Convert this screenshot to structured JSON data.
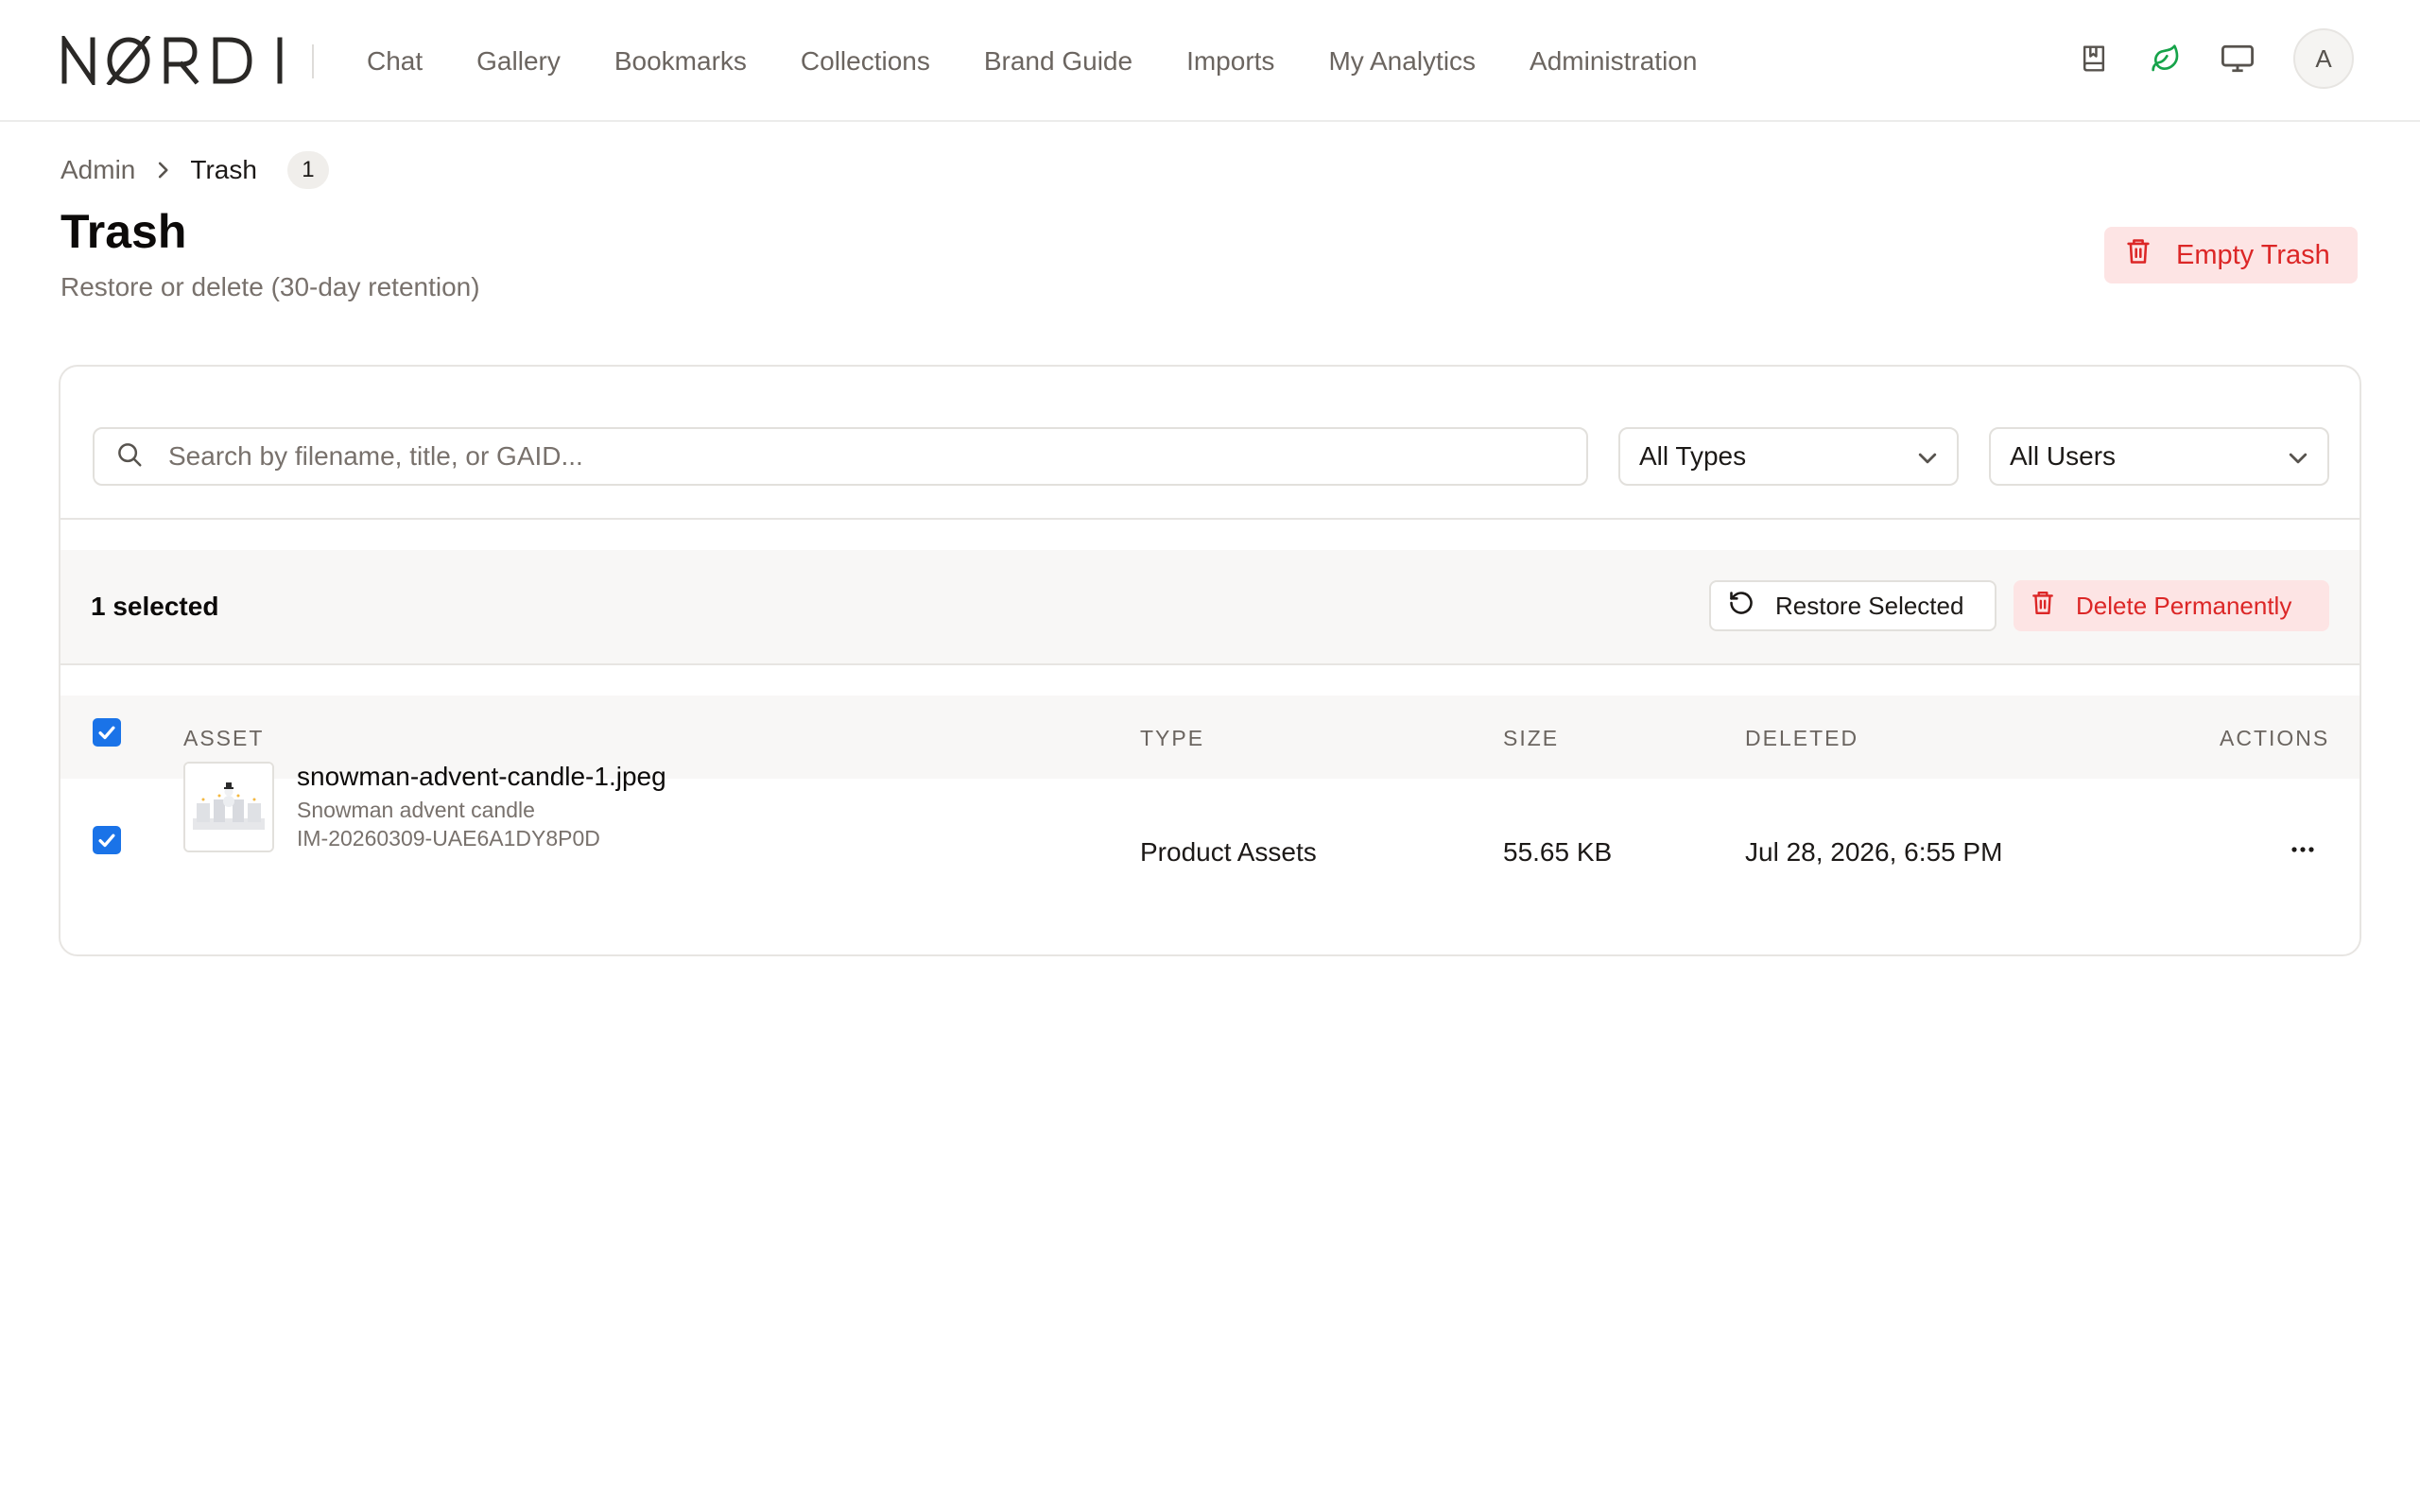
{
  "brand": {
    "logo_text": "NØRDI"
  },
  "nav": {
    "items": [
      "Chat",
      "Gallery",
      "Bookmarks",
      "Collections",
      "Brand Guide",
      "Imports",
      "My Analytics",
      "Administration"
    ]
  },
  "header_icons": [
    "book-icon",
    "leaf-icon",
    "monitor-icon"
  ],
  "user": {
    "avatar_initial": "A"
  },
  "breadcrumb": {
    "root": "Admin",
    "current": "Trash",
    "count": "1"
  },
  "page": {
    "title": "Trash",
    "subtitle": "Restore or delete (30-day retention)",
    "empty_trash_label": "Empty Trash"
  },
  "filters": {
    "search_placeholder": "Search by filename, title, or GAID...",
    "type_selected": "All Types",
    "user_selected": "All Users"
  },
  "selection": {
    "count_label": "1 selected",
    "restore_label": "Restore Selected",
    "delete_label": "Delete Permanently"
  },
  "table": {
    "columns": [
      "ASSET",
      "TYPE",
      "SIZE",
      "DELETED",
      "ACTIONS"
    ],
    "rows": [
      {
        "checked": true,
        "filename": "snowman-advent-candle-1.jpeg",
        "title": "Snowman advent candle",
        "gaid": "IM-20260309-UAE6A1DY8P0D",
        "type": "Product Assets",
        "size": "55.65 KB",
        "deleted": "Jul 28, 2026, 6:55 PM"
      }
    ]
  },
  "colors": {
    "accent_blue": "#1a73e8",
    "danger": "#dc2626",
    "danger_bg": "#fde4e4",
    "leaf_green": "#16a34a"
  }
}
